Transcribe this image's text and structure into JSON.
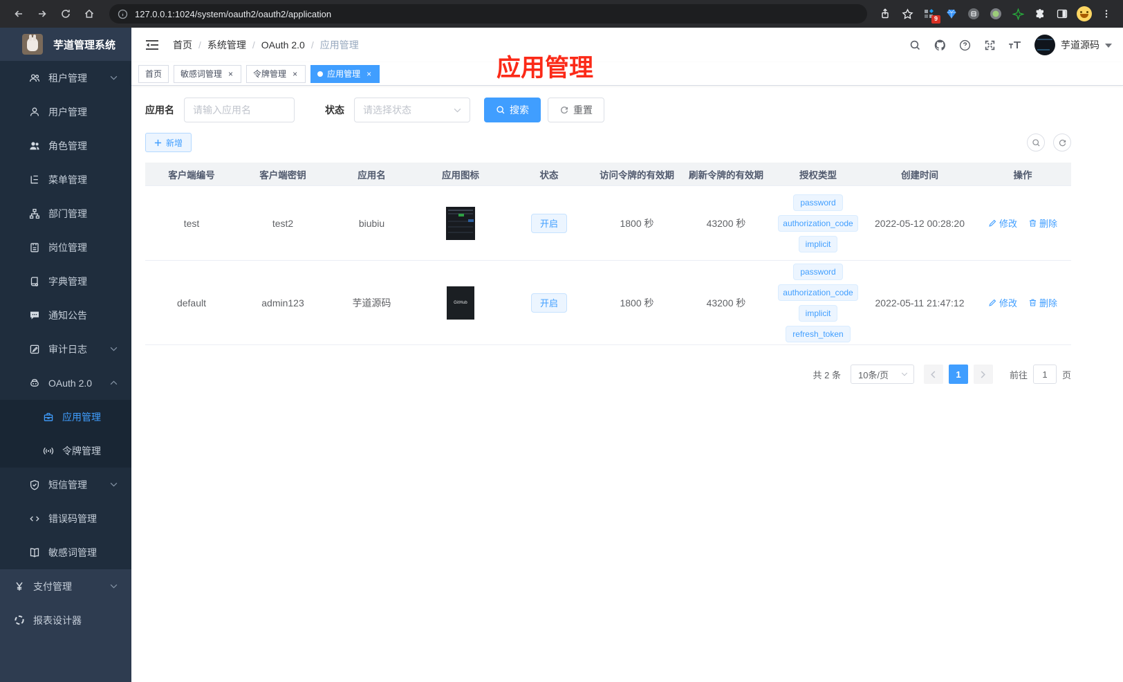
{
  "browser": {
    "url": "127.0.0.1:1024/system/oauth2/oauth2/application",
    "extension_badge": "9"
  },
  "sidebar": {
    "title": "芋道管理系统",
    "items": [
      {
        "id": "tenant",
        "label": "租户管理",
        "icon": "tenant-users-icon",
        "level": 2,
        "chevron": "down"
      },
      {
        "id": "user",
        "label": "用户管理",
        "icon": "user-icon",
        "level": 2
      },
      {
        "id": "role",
        "label": "角色管理",
        "icon": "roles-icon",
        "level": 2
      },
      {
        "id": "menu",
        "label": "菜单管理",
        "icon": "menu-tree-icon",
        "level": 2
      },
      {
        "id": "dept",
        "label": "部门管理",
        "icon": "org-chart-icon",
        "level": 2
      },
      {
        "id": "post",
        "label": "岗位管理",
        "icon": "post-badge-icon",
        "level": 2
      },
      {
        "id": "dict",
        "label": "字典管理",
        "icon": "dictionary-icon",
        "level": 2
      },
      {
        "id": "notice",
        "label": "通知公告",
        "icon": "notice-bubble-icon",
        "level": 2
      },
      {
        "id": "audit",
        "label": "审计日志",
        "icon": "audit-log-icon",
        "level": 2,
        "chevron": "down"
      },
      {
        "id": "oauth2",
        "label": "OAuth 2.0",
        "icon": "oauth-robot-icon",
        "level": 2,
        "chevron": "up"
      },
      {
        "id": "oauth-app",
        "label": "应用管理",
        "icon": "application-icon",
        "level": 3,
        "active": true
      },
      {
        "id": "oauth-token",
        "label": "令牌管理",
        "icon": "token-signal-icon",
        "level": 3
      },
      {
        "id": "sms",
        "label": "短信管理",
        "icon": "sms-shield-icon",
        "level": 2,
        "chevron": "down"
      },
      {
        "id": "errcode",
        "label": "错误码管理",
        "icon": "error-code-icon",
        "level": 2
      },
      {
        "id": "sensitive",
        "label": "敏感词管理",
        "icon": "sensitive-word-icon",
        "level": 2
      },
      {
        "id": "pay",
        "label": "支付管理",
        "icon": "pay-yen-icon",
        "level": 1,
        "chevron": "down"
      },
      {
        "id": "report",
        "label": "报表设计器",
        "icon": "report-designer-icon",
        "level": 1
      }
    ]
  },
  "header": {
    "breadcrumb": [
      "首页",
      "系统管理",
      "OAuth 2.0",
      "应用管理"
    ],
    "username": "芋道源码"
  },
  "tabs": [
    {
      "label": "首页",
      "closable": false,
      "active": false
    },
    {
      "label": "敏感词管理",
      "closable": true,
      "active": false
    },
    {
      "label": "令牌管理",
      "closable": true,
      "active": false
    },
    {
      "label": "应用管理",
      "closable": true,
      "active": true
    }
  ],
  "annotation": {
    "text": "应用管理",
    "color": "#fb2a18"
  },
  "filters": {
    "name_label": "应用名",
    "name_placeholder": "请输入应用名",
    "status_label": "状态",
    "status_placeholder": "请选择状态",
    "search_label": "搜索",
    "reset_label": "重置"
  },
  "toolbar": {
    "add_label": "新增"
  },
  "table": {
    "columns": [
      "客户端编号",
      "客户端密钥",
      "应用名",
      "应用图标",
      "状态",
      "访问令牌的有效期",
      "刷新令牌的有效期",
      "授权类型",
      "创建时间",
      "操作"
    ],
    "rows": [
      {
        "client_id": "test",
        "client_secret": "test2",
        "app_name": "biubiu",
        "icon": "app-screenshot-thumbnail",
        "icon_text": "",
        "status": "开启",
        "access_token_validity": "1800 秒",
        "refresh_token_validity": "43200 秒",
        "grant_types": [
          "password",
          "authorization_code",
          "implicit"
        ],
        "created_at": "2022-05-12 00:28:20"
      },
      {
        "client_id": "default",
        "client_secret": "admin123",
        "app_name": "芋道源码",
        "icon": "github-dark-thumbnail",
        "icon_text": "GitHub",
        "status": "开启",
        "access_token_validity": "1800 秒",
        "refresh_token_validity": "43200 秒",
        "grant_types": [
          "password",
          "authorization_code",
          "implicit",
          "refresh_token"
        ],
        "created_at": "2022-05-11 21:47:12"
      }
    ],
    "actions": {
      "edit": "修改",
      "delete": "删除"
    }
  },
  "pagination": {
    "total": "共 2 条",
    "page_size": "10条/页",
    "current_page": "1",
    "goto_label": "前往",
    "goto_value": "1",
    "page_unit": "页"
  },
  "colors": {
    "accent": "#409eff",
    "annotation_red": "#fb2a18",
    "sidebar_bg": "#2e3c50",
    "submenu_bg": "#1f2d3d"
  }
}
